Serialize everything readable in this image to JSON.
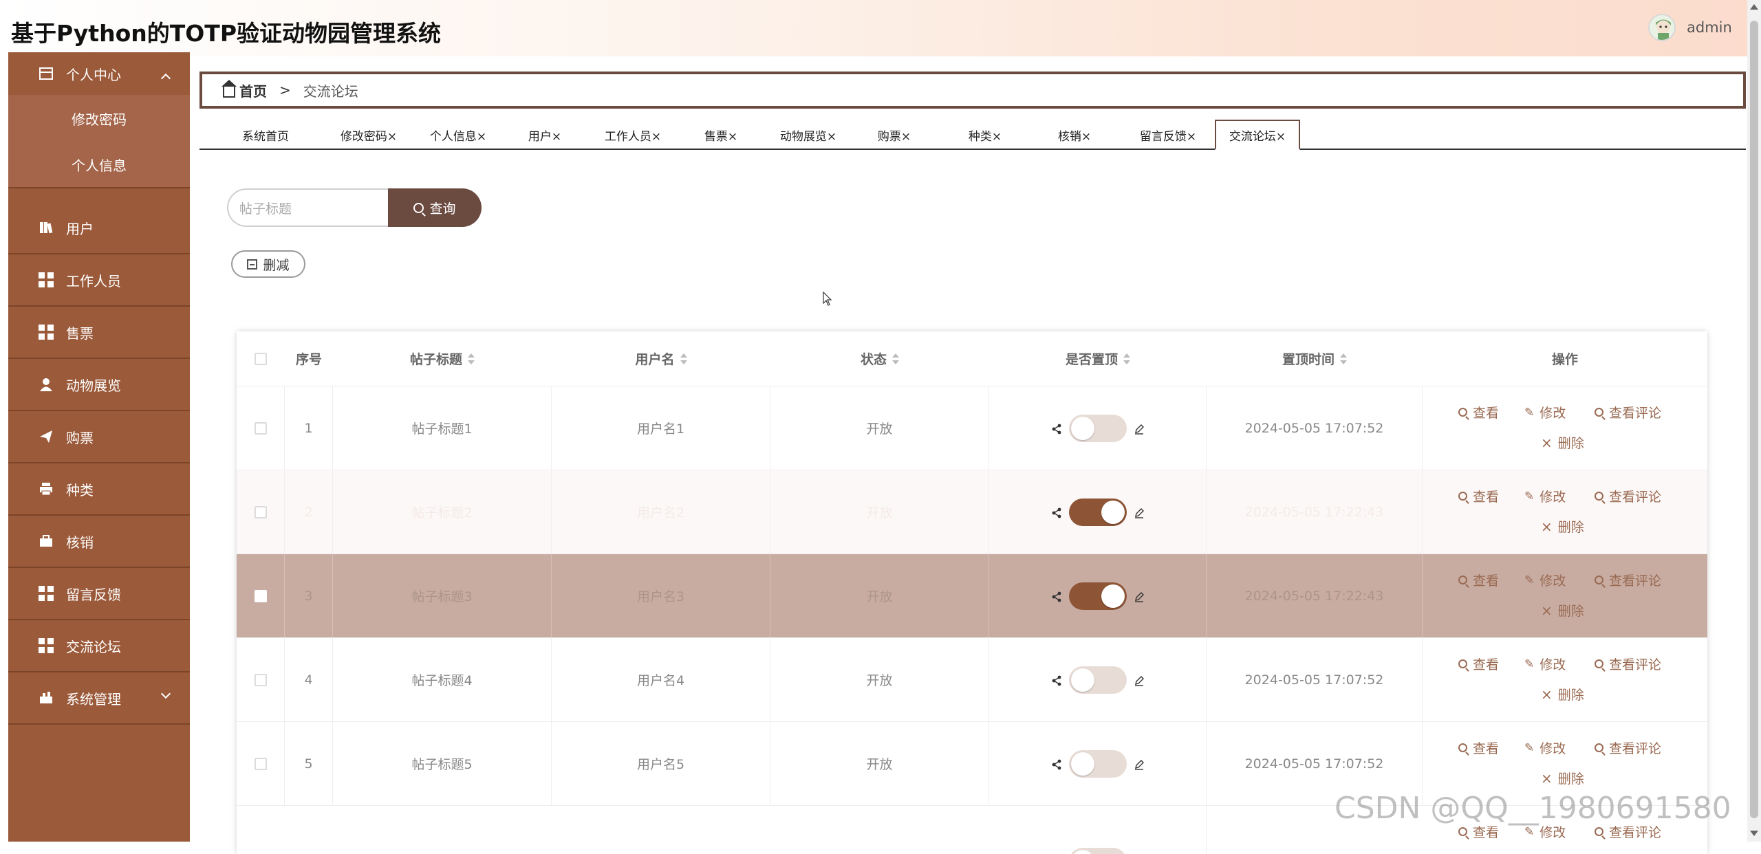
{
  "app": {
    "title": "基于Python的TOTP验证动物园管理系统",
    "user": "admin"
  },
  "sidebar": {
    "group_title": "个人中心",
    "sub_items": [
      "修改密码",
      "个人信息"
    ],
    "items": [
      {
        "label": "用户",
        "icon": "book-icon"
      },
      {
        "label": "工作人员",
        "icon": "grid-icon"
      },
      {
        "label": "售票",
        "icon": "grid-icon"
      },
      {
        "label": "动物展览",
        "icon": "person-icon"
      },
      {
        "label": "购票",
        "icon": "paper-plane-icon"
      },
      {
        "label": "种类",
        "icon": "printer-icon"
      },
      {
        "label": "核销",
        "icon": "briefcase-icon"
      },
      {
        "label": "留言反馈",
        "icon": "grid-icon"
      },
      {
        "label": "交流论坛",
        "icon": "grid-icon"
      },
      {
        "label": "系统管理",
        "icon": "settings-icon"
      }
    ]
  },
  "breadcrumb": {
    "home": "首页",
    "sep": ">",
    "current": "交流论坛"
  },
  "tabs": [
    "系统首页",
    "修改密码×",
    "个人信息×",
    "用户×",
    "工作人员×",
    "售票×",
    "动物展览×",
    "购票×",
    "种类×",
    "核销×",
    "留言反馈×",
    "交流论坛×"
  ],
  "search": {
    "placeholder": "帖子标题",
    "button": "查询"
  },
  "toolbar": {
    "delete": "删减"
  },
  "table": {
    "headers": [
      "序号",
      "帖子标题",
      "用户名",
      "状态",
      "是否置顶",
      "置顶时间",
      "操作"
    ],
    "rows": [
      {
        "no": "1",
        "title": "帖子标题1",
        "user": "用户名1",
        "status": "开放",
        "pinned": false,
        "time": "2024-05-05 17:07:52"
      },
      {
        "no": "2",
        "title": "帖子标题2",
        "user": "用户名2",
        "status": "开放",
        "pinned": true,
        "time": "2024-05-05 17:22:43"
      },
      {
        "no": "3",
        "title": "帖子标题3",
        "user": "用户名3",
        "status": "开放",
        "pinned": true,
        "time": "2024-05-05 17:22:43"
      },
      {
        "no": "4",
        "title": "帖子标题4",
        "user": "用户名4",
        "status": "开放",
        "pinned": false,
        "time": "2024-05-05 17:07:52"
      },
      {
        "no": "5",
        "title": "帖子标题5",
        "user": "用户名5",
        "status": "开放",
        "pinned": false,
        "time": "2024-05-05 17:07:52"
      }
    ],
    "actions": {
      "view": "查看",
      "edit": "修改",
      "comments": "查看评论",
      "delete": "删除"
    }
  },
  "watermark": "CSDN @QQ__1980691580",
  "colors": {
    "sidebar": "#9b5a3a",
    "accent": "#6b4a40",
    "toggle_on": "#8e5436",
    "selected_row": "#c8aca2"
  }
}
